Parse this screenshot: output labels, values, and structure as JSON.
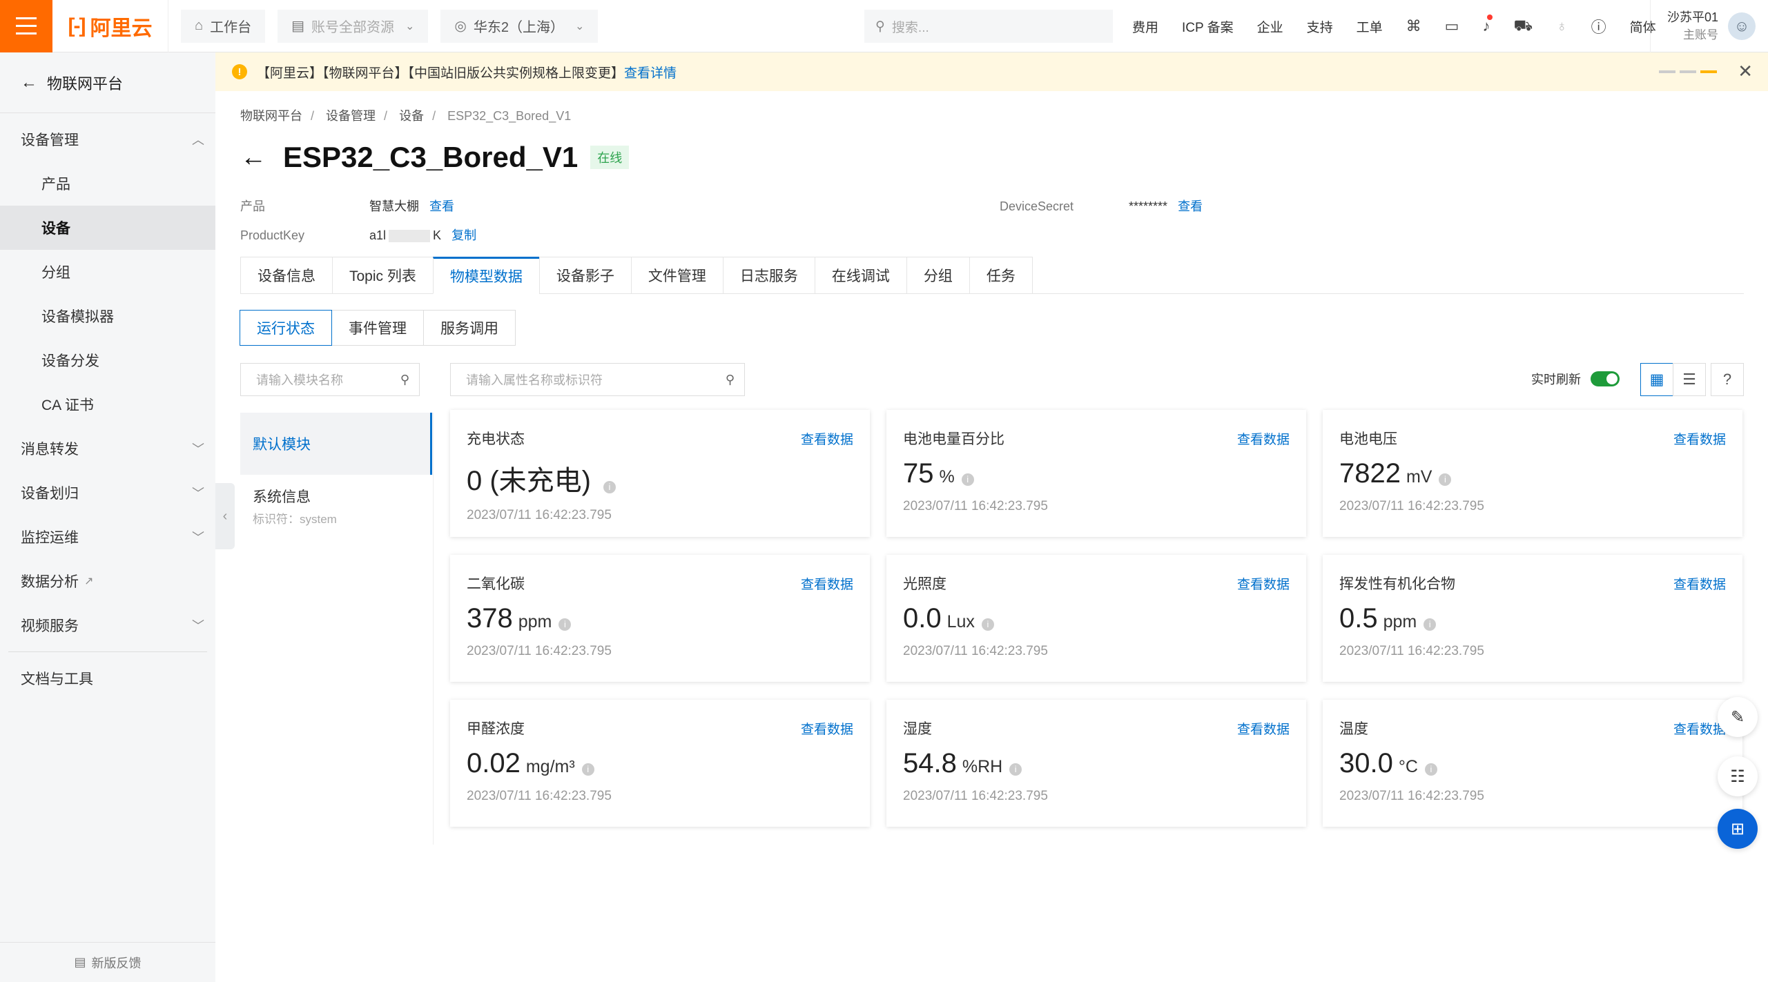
{
  "header": {
    "logo_text": "阿里云",
    "workbench": "工作台",
    "resources": "账号全部资源",
    "region": "华东2（上海）",
    "search_placeholder": "搜索...",
    "links": [
      "费用",
      "ICP 备案",
      "企业",
      "支持",
      "工单"
    ],
    "lang": "简体",
    "user_name": "沙苏平01",
    "user_role": "主账号"
  },
  "sidebar": {
    "back_label": "物联网平台",
    "items": [
      {
        "label": "设备管理",
        "level": 1,
        "chevron": "up"
      },
      {
        "label": "产品",
        "level": 2
      },
      {
        "label": "设备",
        "level": 2,
        "active": true
      },
      {
        "label": "分组",
        "level": 2
      },
      {
        "label": "设备模拟器",
        "level": 2
      },
      {
        "label": "设备分发",
        "level": 2
      },
      {
        "label": "CA 证书",
        "level": 2
      },
      {
        "label": "消息转发",
        "level": 1,
        "chevron": "down"
      },
      {
        "label": "设备划归",
        "level": 1,
        "chevron": "down"
      },
      {
        "label": "监控运维",
        "level": 1,
        "chevron": "down"
      },
      {
        "label": "数据分析",
        "level": 1,
        "external": true
      },
      {
        "label": "视频服务",
        "level": 1,
        "chevron": "down"
      },
      {
        "label": "文档与工具",
        "level": 1
      }
    ],
    "feedback": "新版反馈"
  },
  "notice": {
    "text": "【阿里云】【物联网平台】【中国站旧版公共实例规格上限变更】",
    "link": "查看详情"
  },
  "breadcrumb": [
    "物联网平台",
    "设备管理",
    "设备",
    "ESP32_C3_Bored_V1"
  ],
  "device": {
    "name": "ESP32_C3_Bored_V1",
    "status": "在线",
    "product_label": "产品",
    "product_value": "智慧大棚",
    "product_link": "查看",
    "productkey_label": "ProductKey",
    "productkey_prefix": "a1l",
    "productkey_suffix": "K",
    "productkey_link": "复制",
    "secret_label": "DeviceSecret",
    "secret_value": "********",
    "secret_link": "查看"
  },
  "tabs": [
    "设备信息",
    "Topic 列表",
    "物模型数据",
    "设备影子",
    "文件管理",
    "日志服务",
    "在线调试",
    "分组",
    "任务"
  ],
  "active_tab": "物模型数据",
  "subtabs": [
    "运行状态",
    "事件管理",
    "服务调用"
  ],
  "module_search_placeholder": "请输入模块名称",
  "property_search_placeholder": "请输入属性名称或标识符",
  "realtime_label": "实时刷新",
  "modules": [
    {
      "name": "默认模块",
      "active": true
    },
    {
      "name": "系统信息",
      "identifier": "标识符：system"
    }
  ],
  "view_data_label": "查看数据",
  "cards": [
    {
      "name": "充电状态",
      "value": "0 (未充电)",
      "unit": "",
      "time": "2023/07/11 16:42:23.795"
    },
    {
      "name": "电池电量百分比",
      "value": "75",
      "unit": "%",
      "time": "2023/07/11 16:42:23.795"
    },
    {
      "name": "电池电压",
      "value": "7822",
      "unit": "mV",
      "time": "2023/07/11 16:42:23.795"
    },
    {
      "name": "二氧化碳",
      "value": "378",
      "unit": "ppm",
      "time": "2023/07/11 16:42:23.795"
    },
    {
      "name": "光照度",
      "value": "0.0",
      "unit": "Lux",
      "time": "2023/07/11 16:42:23.795"
    },
    {
      "name": "挥发性有机化合物",
      "value": "0.5",
      "unit": "ppm",
      "time": "2023/07/11 16:42:23.795"
    },
    {
      "name": "甲醛浓度",
      "value": "0.02",
      "unit": "mg/m³",
      "time": "2023/07/11 16:42:23.795"
    },
    {
      "name": "湿度",
      "value": "54.8",
      "unit": "%RH",
      "time": "2023/07/11 16:42:23.795"
    },
    {
      "name": "温度",
      "value": "30.0",
      "unit": "°C",
      "time": "2023/07/11 16:42:23.795"
    }
  ],
  "colors": {
    "brand": "#ff6a00",
    "link": "#0070cc",
    "online": "#2ea44f",
    "switch": "#1e9b3a"
  }
}
